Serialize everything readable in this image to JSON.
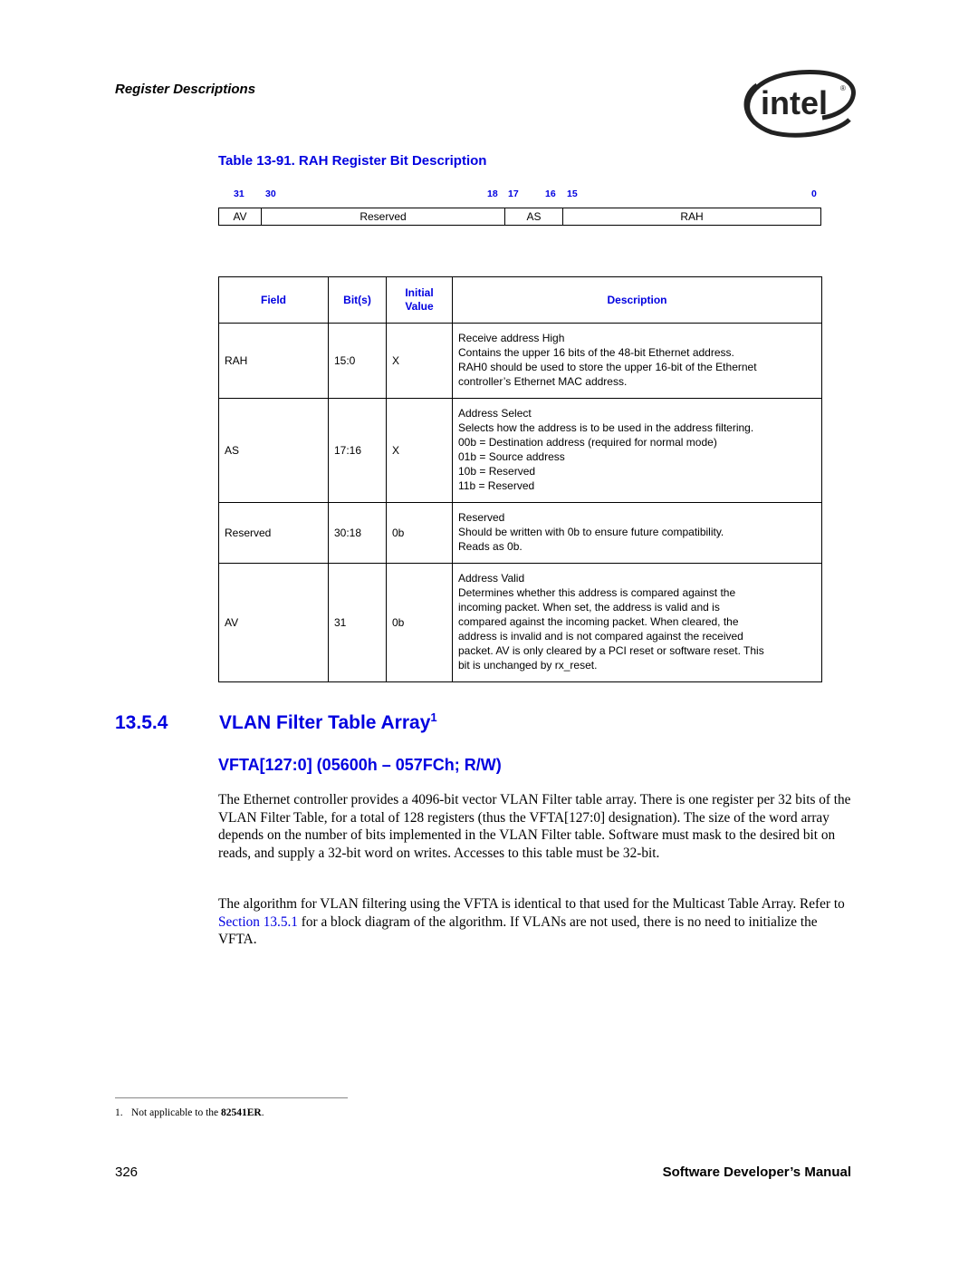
{
  "header": {
    "running_head": "Register Descriptions",
    "logo_text": "intel",
    "logo_mark": "®"
  },
  "table_caption": "Table 13-91. RAH Register Bit Description",
  "register_layout": {
    "bit_numbers": [
      "31",
      "30",
      "18",
      "17",
      "16",
      "15",
      "0"
    ],
    "fields": [
      {
        "name": "AV",
        "bits": "31"
      },
      {
        "name": "Reserved",
        "bits": "30:18"
      },
      {
        "name": "AS",
        "bits": "17:16"
      },
      {
        "name": "RAH",
        "bits": "15:0"
      }
    ]
  },
  "bit_table": {
    "headers": {
      "field": "Field",
      "bits": "Bit(s)",
      "initial_line1": "Initial",
      "initial_line2": "Value",
      "description": "Description"
    },
    "rows": [
      {
        "field": "RAH",
        "bits": "15:0",
        "initial": "X",
        "desc": [
          "Receive address High",
          "Contains the upper 16 bits of the 48-bit Ethernet address.",
          "RAH0 should be used to store the upper 16-bit of the Ethernet",
          "controller’s Ethernet MAC address."
        ]
      },
      {
        "field": "AS",
        "bits": "17:16",
        "initial": "X",
        "desc": [
          "Address Select",
          "Selects how the address is to be used in the address filtering.",
          "00b = Destination address (required for normal mode)",
          "01b = Source address",
          "10b = Reserved",
          "11b = Reserved"
        ]
      },
      {
        "field": "Reserved",
        "bits": "30:18",
        "initial": "0b",
        "desc": [
          "Reserved",
          "Should be written with 0b to ensure future compatibility.",
          "Reads as 0b."
        ]
      },
      {
        "field": "AV",
        "bits": "31",
        "initial": "0b",
        "desc": [
          "Address Valid",
          "Determines whether this address is compared against the",
          "incoming packet. When set, the address is valid and is",
          "compared against the incoming packet. When cleared, the",
          "address is invalid and is not compared against the received",
          "packet. AV is only cleared by a PCI reset or software reset. This",
          "bit is unchanged by rx_reset."
        ]
      }
    ]
  },
  "section": {
    "number": "13.5.4",
    "title": "VLAN Filter Table Array",
    "footnote_ref": "1",
    "register_heading": "VFTA[127:0] (05600h – 057FCh; R/W)"
  },
  "paragraphs": {
    "p1": "The Ethernet controller provides a 4096-bit vector VLAN Filter table array. There is one register per 32 bits of the VLAN Filter Table, for a total of 128 registers (thus the VFTA[127:0] designation). The size of the word array depends on the number of bits implemented in the VLAN Filter table. Software must mask to the desired bit on reads, and supply a 32-bit word on writes. Accesses to this table must be 32-bit.",
    "p2_before": "The algorithm for VLAN filtering using the VFTA is identical to that used for the Multicast Table Array. Refer to ",
    "p2_link": "Section 13.5.1",
    "p2_after": " for a block diagram of the algorithm. If VLANs are not used, there is no need to initialize the VFTA."
  },
  "footnote": {
    "marker": "1.",
    "text": "Not applicable to the ",
    "bold": "82541ER",
    "end": "."
  },
  "footer": {
    "page_number": "326",
    "manual_title": "Software Developer’s Manual"
  },
  "colors": {
    "accent": "#0000e0"
  }
}
